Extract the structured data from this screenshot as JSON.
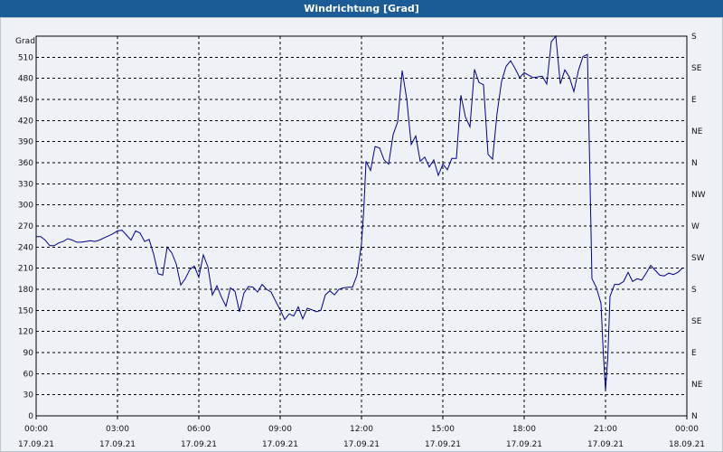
{
  "window": {
    "title": "Windrichtung [Grad]"
  },
  "chart_data": {
    "type": "line",
    "title": "Windrichtung [Grad]",
    "ylabel": "Grad",
    "ylim": [
      0,
      540
    ],
    "xlim": [
      "2021-09-17 00:00",
      "2021-09-18 00:00"
    ],
    "y_ticks": [
      0,
      30,
      60,
      90,
      120,
      150,
      180,
      210,
      240,
      270,
      300,
      330,
      360,
      390,
      420,
      450,
      480,
      510
    ],
    "right_axis_labels": [
      "N",
      "NE",
      "E",
      "SE",
      "S",
      "SW",
      "W",
      "NW",
      "N",
      "NE",
      "E",
      "SE",
      "S"
    ],
    "x_ticks": [
      {
        "time": "00:00",
        "date": "17.09.21"
      },
      {
        "time": "03:00",
        "date": "17.09.21"
      },
      {
        "time": "06:00",
        "date": "17.09.21"
      },
      {
        "time": "09:00",
        "date": "17.09.21"
      },
      {
        "time": "12:00",
        "date": "17.09.21"
      },
      {
        "time": "15:00",
        "date": "17.09.21"
      },
      {
        "time": "18:00",
        "date": "17.09.21"
      },
      {
        "time": "21:00",
        "date": "17.09.21"
      },
      {
        "time": "00:00",
        "date": "18.09.21"
      }
    ],
    "grid": true,
    "line_color": "#00008b",
    "series": [
      {
        "points": [
          [
            "00:00",
            255
          ],
          [
            "00:10",
            255
          ],
          [
            "00:20",
            250
          ],
          [
            "00:30",
            242
          ],
          [
            "00:40",
            242
          ],
          [
            "00:50",
            246
          ],
          [
            "01:00",
            248
          ],
          [
            "01:10",
            252
          ],
          [
            "01:20",
            250
          ],
          [
            "01:30",
            247
          ],
          [
            "01:40",
            247
          ],
          [
            "01:50",
            248
          ],
          [
            "02:00",
            249
          ],
          [
            "02:10",
            248
          ],
          [
            "02:20",
            250
          ],
          [
            "02:30",
            253
          ],
          [
            "02:40",
            256
          ],
          [
            "02:50",
            259
          ],
          [
            "03:00",
            263
          ],
          [
            "03:10",
            264
          ],
          [
            "03:20",
            257
          ],
          [
            "03:30",
            250
          ],
          [
            "03:40",
            263
          ],
          [
            "03:50",
            260
          ],
          [
            "04:00",
            248
          ],
          [
            "04:10",
            251
          ],
          [
            "04:20",
            230
          ],
          [
            "04:30",
            202
          ],
          [
            "04:40",
            200
          ],
          [
            "04:50",
            240
          ],
          [
            "05:00",
            232
          ],
          [
            "05:10",
            216
          ],
          [
            "05:20",
            186
          ],
          [
            "05:30",
            195
          ],
          [
            "05:40",
            208
          ],
          [
            "05:50",
            213
          ],
          [
            "06:00",
            197
          ],
          [
            "06:10",
            229
          ],
          [
            "06:20",
            212
          ],
          [
            "06:30",
            172
          ],
          [
            "06:40",
            185
          ],
          [
            "06:50",
            169
          ],
          [
            "07:00",
            156
          ],
          [
            "07:10",
            182
          ],
          [
            "07:20",
            177
          ],
          [
            "07:30",
            148
          ],
          [
            "07:40",
            175
          ],
          [
            "07:50",
            184
          ],
          [
            "08:00",
            183
          ],
          [
            "08:10",
            176
          ],
          [
            "08:20",
            187
          ],
          [
            "08:30",
            180
          ],
          [
            "08:40",
            176
          ],
          [
            "08:50",
            163
          ],
          [
            "09:00",
            151
          ],
          [
            "09:10",
            137
          ],
          [
            "09:20",
            145
          ],
          [
            "09:30",
            142
          ],
          [
            "09:40",
            155
          ],
          [
            "09:50",
            138
          ],
          [
            "10:00",
            153
          ],
          [
            "10:10",
            151
          ],
          [
            "10:20",
            148
          ],
          [
            "10:30",
            150
          ],
          [
            "10:40",
            172
          ],
          [
            "10:50",
            178
          ],
          [
            "11:00",
            172
          ],
          [
            "11:10",
            180
          ],
          [
            "11:20",
            182
          ],
          [
            "11:30",
            183
          ],
          [
            "11:40",
            183
          ],
          [
            "11:50",
            200
          ],
          [
            "12:00",
            245
          ],
          [
            "12:05",
            292
          ],
          [
            "12:10",
            362
          ],
          [
            "12:20",
            349
          ],
          [
            "12:30",
            383
          ],
          [
            "12:40",
            381
          ],
          [
            "12:50",
            364
          ],
          [
            "13:00",
            358
          ],
          [
            "13:10",
            400
          ],
          [
            "13:20",
            418
          ],
          [
            "13:30",
            491
          ],
          [
            "13:40",
            451
          ],
          [
            "13:50",
            386
          ],
          [
            "14:00",
            398
          ],
          [
            "14:10",
            362
          ],
          [
            "14:20",
            368
          ],
          [
            "14:30",
            354
          ],
          [
            "14:40",
            364
          ],
          [
            "14:50",
            342
          ],
          [
            "15:00",
            358
          ],
          [
            "15:10",
            350
          ],
          [
            "15:20",
            366
          ],
          [
            "15:30",
            366
          ],
          [
            "15:40",
            456
          ],
          [
            "15:50",
            425
          ],
          [
            "16:00",
            411
          ],
          [
            "16:10",
            493
          ],
          [
            "16:20",
            474
          ],
          [
            "16:30",
            471
          ],
          [
            "16:40",
            372
          ],
          [
            "16:50",
            365
          ],
          [
            "17:00",
            430
          ],
          [
            "17:10",
            476
          ],
          [
            "17:20",
            497
          ],
          [
            "17:30",
            505
          ],
          [
            "17:40",
            494
          ],
          [
            "17:50",
            481
          ],
          [
            "18:00",
            488
          ],
          [
            "18:20",
            481
          ],
          [
            "18:40",
            483
          ],
          [
            "18:50",
            472
          ],
          [
            "19:00",
            532
          ],
          [
            "19:10",
            540
          ],
          [
            "19:20",
            472
          ],
          [
            "19:30",
            492
          ],
          [
            "19:40",
            482
          ],
          [
            "19:50",
            461
          ],
          [
            "20:00",
            491
          ],
          [
            "20:10",
            511
          ],
          [
            "20:20",
            514
          ],
          [
            "20:25",
            357
          ],
          [
            "20:30",
            195
          ],
          [
            "20:40",
            182
          ],
          [
            "20:50",
            160
          ],
          [
            "20:55",
            91
          ],
          [
            "21:00",
            36
          ],
          [
            "21:05",
            82
          ],
          [
            "21:10",
            170
          ],
          [
            "21:20",
            187
          ],
          [
            "21:30",
            187
          ],
          [
            "21:40",
            191
          ],
          [
            "21:50",
            204
          ],
          [
            "22:00",
            191
          ],
          [
            "22:10",
            195
          ],
          [
            "22:20",
            193
          ],
          [
            "22:30",
            203
          ],
          [
            "22:40",
            214
          ],
          [
            "22:50",
            207
          ],
          [
            "23:00",
            200
          ],
          [
            "23:10",
            199
          ],
          [
            "23:20",
            203
          ],
          [
            "23:30",
            201
          ],
          [
            "23:40",
            204
          ],
          [
            "23:50",
            210
          ]
        ]
      }
    ]
  }
}
